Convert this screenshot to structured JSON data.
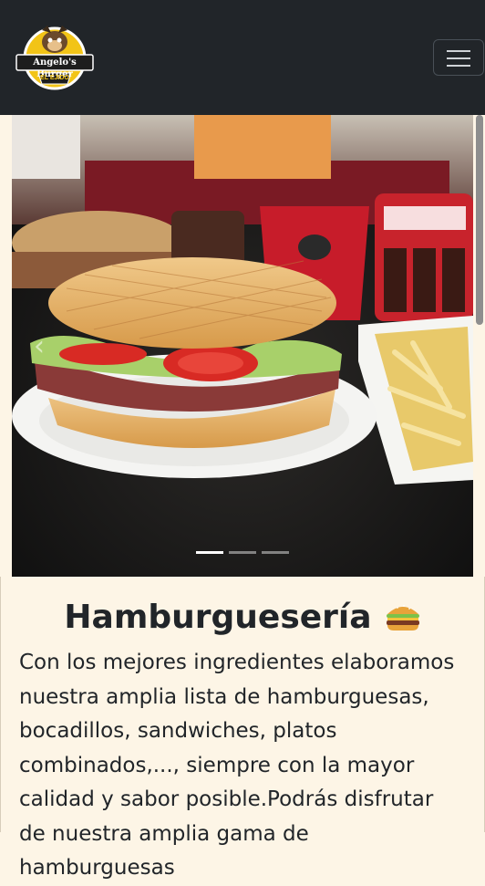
{
  "brand": {
    "name_line1": "Angelo's Burger",
    "name_line2": "EL EJIDO"
  },
  "navbar": {
    "toggler_icon": "hamburger-menu-icon"
  },
  "carousel": {
    "prev_icon": "chevron-left-icon",
    "prev_symbol": "‹",
    "indicators": [
      "slide-1",
      "slide-2",
      "slide-3"
    ],
    "active_index": 0,
    "image_description": "Burger with tomato and lettuce, fries and Coca-Cola glass"
  },
  "main": {
    "title": "Hamburguesería",
    "title_emoji": "burger-icon",
    "description": "Con los mejores ingredientes elaboramos nuestra amplia lista de hamburguesas, bocadillos, sandwiches, platos combinados,..., siempre con la mayor calidad y sabor posible.Podrás disfrutar de nuestra amplia gama de hamburguesas"
  },
  "colors": {
    "navbar_bg": "#212529",
    "page_bg": "#fdf5e6",
    "logo_yellow": "#f2c417"
  }
}
